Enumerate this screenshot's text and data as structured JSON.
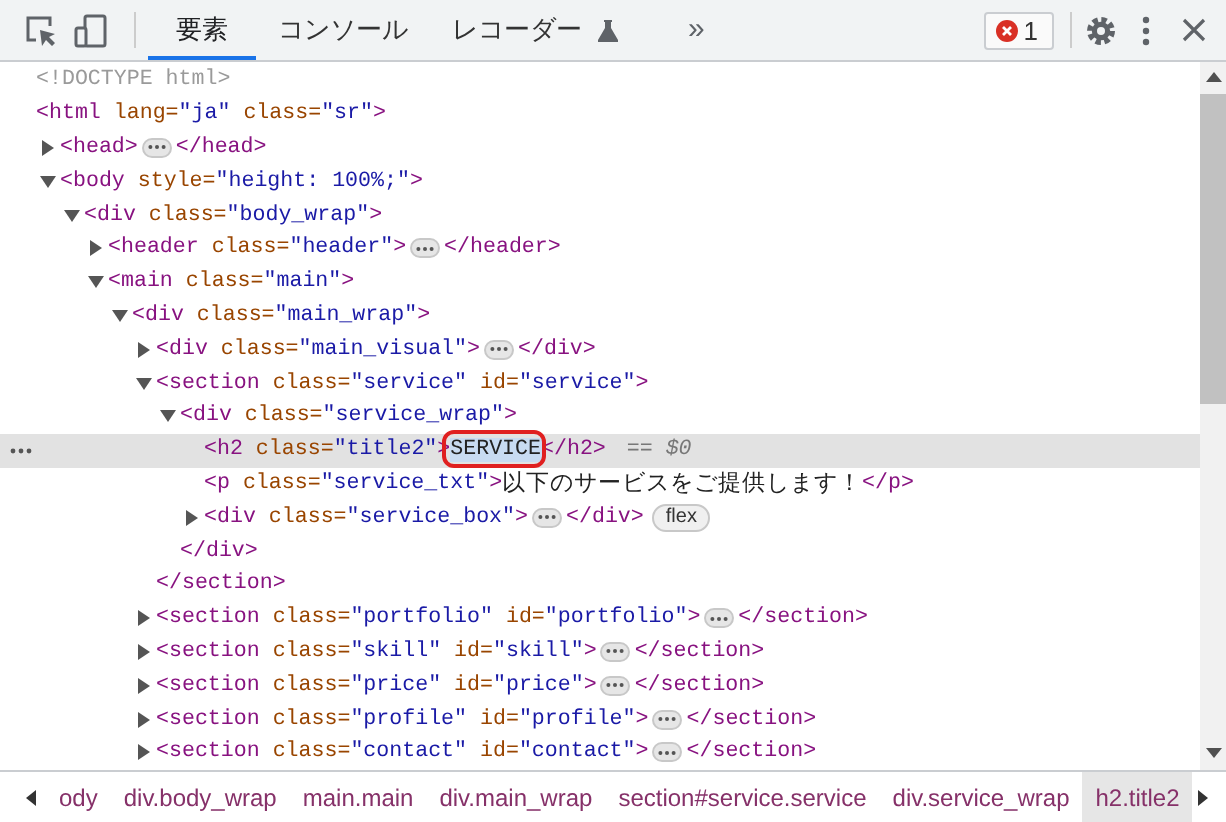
{
  "toolbar": {
    "tabs": [
      {
        "label": "要素",
        "selected": true,
        "experimental": false
      },
      {
        "label": "コンソール",
        "selected": false,
        "experimental": false
      },
      {
        "label": "レコーダー",
        "selected": false,
        "experimental": true
      }
    ],
    "more": "»",
    "error_count": "1"
  },
  "tree": [
    {
      "tokens": [
        {
          "kind": "doctype",
          "text": "<!DOCTYPE html>"
        }
      ],
      "selected": false
    },
    {
      "tokens": [
        {
          "kind": "tag",
          "text": "<html"
        },
        {
          "kind": "attr",
          "text": " lang="
        },
        {
          "kind": "value",
          "text": "\"ja\""
        },
        {
          "kind": "attr",
          "text": " class="
        },
        {
          "kind": "value",
          "text": "\"sr\""
        },
        {
          "kind": "tag",
          "text": ">"
        }
      ],
      "selected": false,
      "children": [
        {
          "tokens": [
            {
              "kind": "tag",
              "text": "<head>"
            },
            {
              "kind": "ellipsis"
            },
            {
              "kind": "tag",
              "text": "</head>"
            }
          ],
          "expanded": false,
          "selected": false
        },
        {
          "tokens": [
            {
              "kind": "tag",
              "text": "<body"
            },
            {
              "kind": "attr",
              "text": " style="
            },
            {
              "kind": "value",
              "text": "\"height: 100%;\""
            },
            {
              "kind": "tag",
              "text": ">"
            }
          ],
          "expanded": true,
          "selected": false,
          "children": [
            {
              "tokens": [
                {
                  "kind": "tag",
                  "text": "<div"
                },
                {
                  "kind": "attr",
                  "text": " class="
                },
                {
                  "kind": "value",
                  "text": "\"body_wrap\""
                },
                {
                  "kind": "tag",
                  "text": ">"
                }
              ],
              "expanded": true,
              "selected": false,
              "children": [
                {
                  "tokens": [
                    {
                      "kind": "tag",
                      "text": "<header"
                    },
                    {
                      "kind": "attr",
                      "text": " class="
                    },
                    {
                      "kind": "value",
                      "text": "\"header\""
                    },
                    {
                      "kind": "tag",
                      "text": ">"
                    },
                    {
                      "kind": "ellipsis"
                    },
                    {
                      "kind": "tag",
                      "text": "</header>"
                    }
                  ],
                  "expanded": false,
                  "selected": false
                },
                {
                  "tokens": [
                    {
                      "kind": "tag",
                      "text": "<main"
                    },
                    {
                      "kind": "attr",
                      "text": " class="
                    },
                    {
                      "kind": "value",
                      "text": "\"main\""
                    },
                    {
                      "kind": "tag",
                      "text": ">"
                    }
                  ],
                  "expanded": true,
                  "selected": false,
                  "children": [
                    {
                      "tokens": [
                        {
                          "kind": "tag",
                          "text": "<div"
                        },
                        {
                          "kind": "attr",
                          "text": " class="
                        },
                        {
                          "kind": "value",
                          "text": "\"main_wrap\""
                        },
                        {
                          "kind": "tag",
                          "text": ">"
                        }
                      ],
                      "expanded": true,
                      "selected": false,
                      "children": [
                        {
                          "tokens": [
                            {
                              "kind": "tag",
                              "text": "<div"
                            },
                            {
                              "kind": "attr",
                              "text": " class="
                            },
                            {
                              "kind": "value",
                              "text": "\"main_visual\""
                            },
                            {
                              "kind": "tag",
                              "text": ">"
                            },
                            {
                              "kind": "ellipsis"
                            },
                            {
                              "kind": "tag",
                              "text": "</div>"
                            }
                          ],
                          "expanded": false,
                          "selected": false
                        },
                        {
                          "tokens": [
                            {
                              "kind": "tag",
                              "text": "<section"
                            },
                            {
                              "kind": "attr",
                              "text": " class="
                            },
                            {
                              "kind": "value",
                              "text": "\"service\""
                            },
                            {
                              "kind": "attr",
                              "text": " id="
                            },
                            {
                              "kind": "value",
                              "text": "\"service\""
                            },
                            {
                              "kind": "tag",
                              "text": ">"
                            }
                          ],
                          "expanded": true,
                          "selected": false,
                          "children": [
                            {
                              "tokens": [
                                {
                                  "kind": "tag",
                                  "text": "<div"
                                },
                                {
                                  "kind": "attr",
                                  "text": " class="
                                },
                                {
                                  "kind": "value",
                                  "text": "\"service_wrap\""
                                },
                                {
                                  "kind": "tag",
                                  "text": ">"
                                }
                              ],
                              "expanded": true,
                              "selected": false,
                              "children": [
                                {
                                  "tokens": [
                                    {
                                      "kind": "tag",
                                      "text": "<h2"
                                    },
                                    {
                                      "kind": "attr",
                                      "text": " class="
                                    },
                                    {
                                      "kind": "value",
                                      "text": "\"title2\""
                                    },
                                    {
                                      "kind": "tag",
                                      "text": ">"
                                    },
                                    {
                                      "kind": "highlighted",
                                      "text": "SERVICE"
                                    },
                                    {
                                      "kind": "tag",
                                      "text": "</h2>"
                                    },
                                    {
                                      "kind": "marker",
                                      "text": " == $0"
                                    }
                                  ],
                                  "selected": true
                                },
                                {
                                  "tokens": [
                                    {
                                      "kind": "tag",
                                      "text": "<p"
                                    },
                                    {
                                      "kind": "attr",
                                      "text": " class="
                                    },
                                    {
                                      "kind": "value",
                                      "text": "\"service_txt\""
                                    },
                                    {
                                      "kind": "tag",
                                      "text": ">"
                                    },
                                    {
                                      "kind": "text",
                                      "text": "以下のサービスをご提供します！"
                                    },
                                    {
                                      "kind": "tag",
                                      "text": "</p>"
                                    }
                                  ],
                                  "selected": false
                                },
                                {
                                  "tokens": [
                                    {
                                      "kind": "tag",
                                      "text": "<div"
                                    },
                                    {
                                      "kind": "attr",
                                      "text": " class="
                                    },
                                    {
                                      "kind": "value",
                                      "text": "\"service_box\""
                                    },
                                    {
                                      "kind": "tag",
                                      "text": ">"
                                    },
                                    {
                                      "kind": "ellipsis"
                                    },
                                    {
                                      "kind": "tag",
                                      "text": "</div>"
                                    },
                                    {
                                      "kind": "badge",
                                      "text": "flex"
                                    }
                                  ],
                                  "expanded": false,
                                  "selected": false
                                }
                              ],
                              "close": [
                                {
                                  "kind": "tag",
                                  "text": "</div>"
                                }
                              ]
                            }
                          ],
                          "close": [
                            {
                              "kind": "tag",
                              "text": "</section>"
                            }
                          ]
                        },
                        {
                          "tokens": [
                            {
                              "kind": "tag",
                              "text": "<section"
                            },
                            {
                              "kind": "attr",
                              "text": " class="
                            },
                            {
                              "kind": "value",
                              "text": "\"portfolio\""
                            },
                            {
                              "kind": "attr",
                              "text": " id="
                            },
                            {
                              "kind": "value",
                              "text": "\"portfolio\""
                            },
                            {
                              "kind": "tag",
                              "text": ">"
                            },
                            {
                              "kind": "ellipsis"
                            },
                            {
                              "kind": "tag",
                              "text": "</section>"
                            }
                          ],
                          "expanded": false,
                          "selected": false
                        },
                        {
                          "tokens": [
                            {
                              "kind": "tag",
                              "text": "<section"
                            },
                            {
                              "kind": "attr",
                              "text": " class="
                            },
                            {
                              "kind": "value",
                              "text": "\"skill\""
                            },
                            {
                              "kind": "attr",
                              "text": " id="
                            },
                            {
                              "kind": "value",
                              "text": "\"skill\""
                            },
                            {
                              "kind": "tag",
                              "text": ">"
                            },
                            {
                              "kind": "ellipsis"
                            },
                            {
                              "kind": "tag",
                              "text": "</section>"
                            }
                          ],
                          "expanded": false,
                          "selected": false
                        },
                        {
                          "tokens": [
                            {
                              "kind": "tag",
                              "text": "<section"
                            },
                            {
                              "kind": "attr",
                              "text": " class="
                            },
                            {
                              "kind": "value",
                              "text": "\"price\""
                            },
                            {
                              "kind": "attr",
                              "text": " id="
                            },
                            {
                              "kind": "value",
                              "text": "\"price\""
                            },
                            {
                              "kind": "tag",
                              "text": ">"
                            },
                            {
                              "kind": "ellipsis"
                            },
                            {
                              "kind": "tag",
                              "text": "</section>"
                            }
                          ],
                          "expanded": false,
                          "selected": false
                        },
                        {
                          "tokens": [
                            {
                              "kind": "tag",
                              "text": "<section"
                            },
                            {
                              "kind": "attr",
                              "text": " class="
                            },
                            {
                              "kind": "value",
                              "text": "\"profile\""
                            },
                            {
                              "kind": "attr",
                              "text": " id="
                            },
                            {
                              "kind": "value",
                              "text": "\"profile\""
                            },
                            {
                              "kind": "tag",
                              "text": ">"
                            },
                            {
                              "kind": "ellipsis"
                            },
                            {
                              "kind": "tag",
                              "text": "</section>"
                            }
                          ],
                          "expanded": false,
                          "selected": false
                        },
                        {
                          "tokens": [
                            {
                              "kind": "tag",
                              "text": "<section"
                            },
                            {
                              "kind": "attr",
                              "text": " class="
                            },
                            {
                              "kind": "value",
                              "text": "\"contact\""
                            },
                            {
                              "kind": "attr",
                              "text": " id="
                            },
                            {
                              "kind": "value",
                              "text": "\"contact\""
                            },
                            {
                              "kind": "tag",
                              "text": ">"
                            },
                            {
                              "kind": "ellipsis"
                            },
                            {
                              "kind": "tag",
                              "text": "</section>"
                            }
                          ],
                          "expanded": false,
                          "selected": false
                        }
                      ]
                    }
                  ]
                }
              ]
            }
          ]
        }
      ]
    }
  ],
  "breadcrumbs": [
    {
      "label": "ody",
      "selected": false
    },
    {
      "label": "div.body_wrap",
      "selected": false
    },
    {
      "label": "main.main",
      "selected": false
    },
    {
      "label": "div.main_wrap",
      "selected": false
    },
    {
      "label": "section#service.service",
      "selected": false
    },
    {
      "label": "div.service_wrap",
      "selected": false
    },
    {
      "label": "h2.title2",
      "selected": true
    }
  ]
}
